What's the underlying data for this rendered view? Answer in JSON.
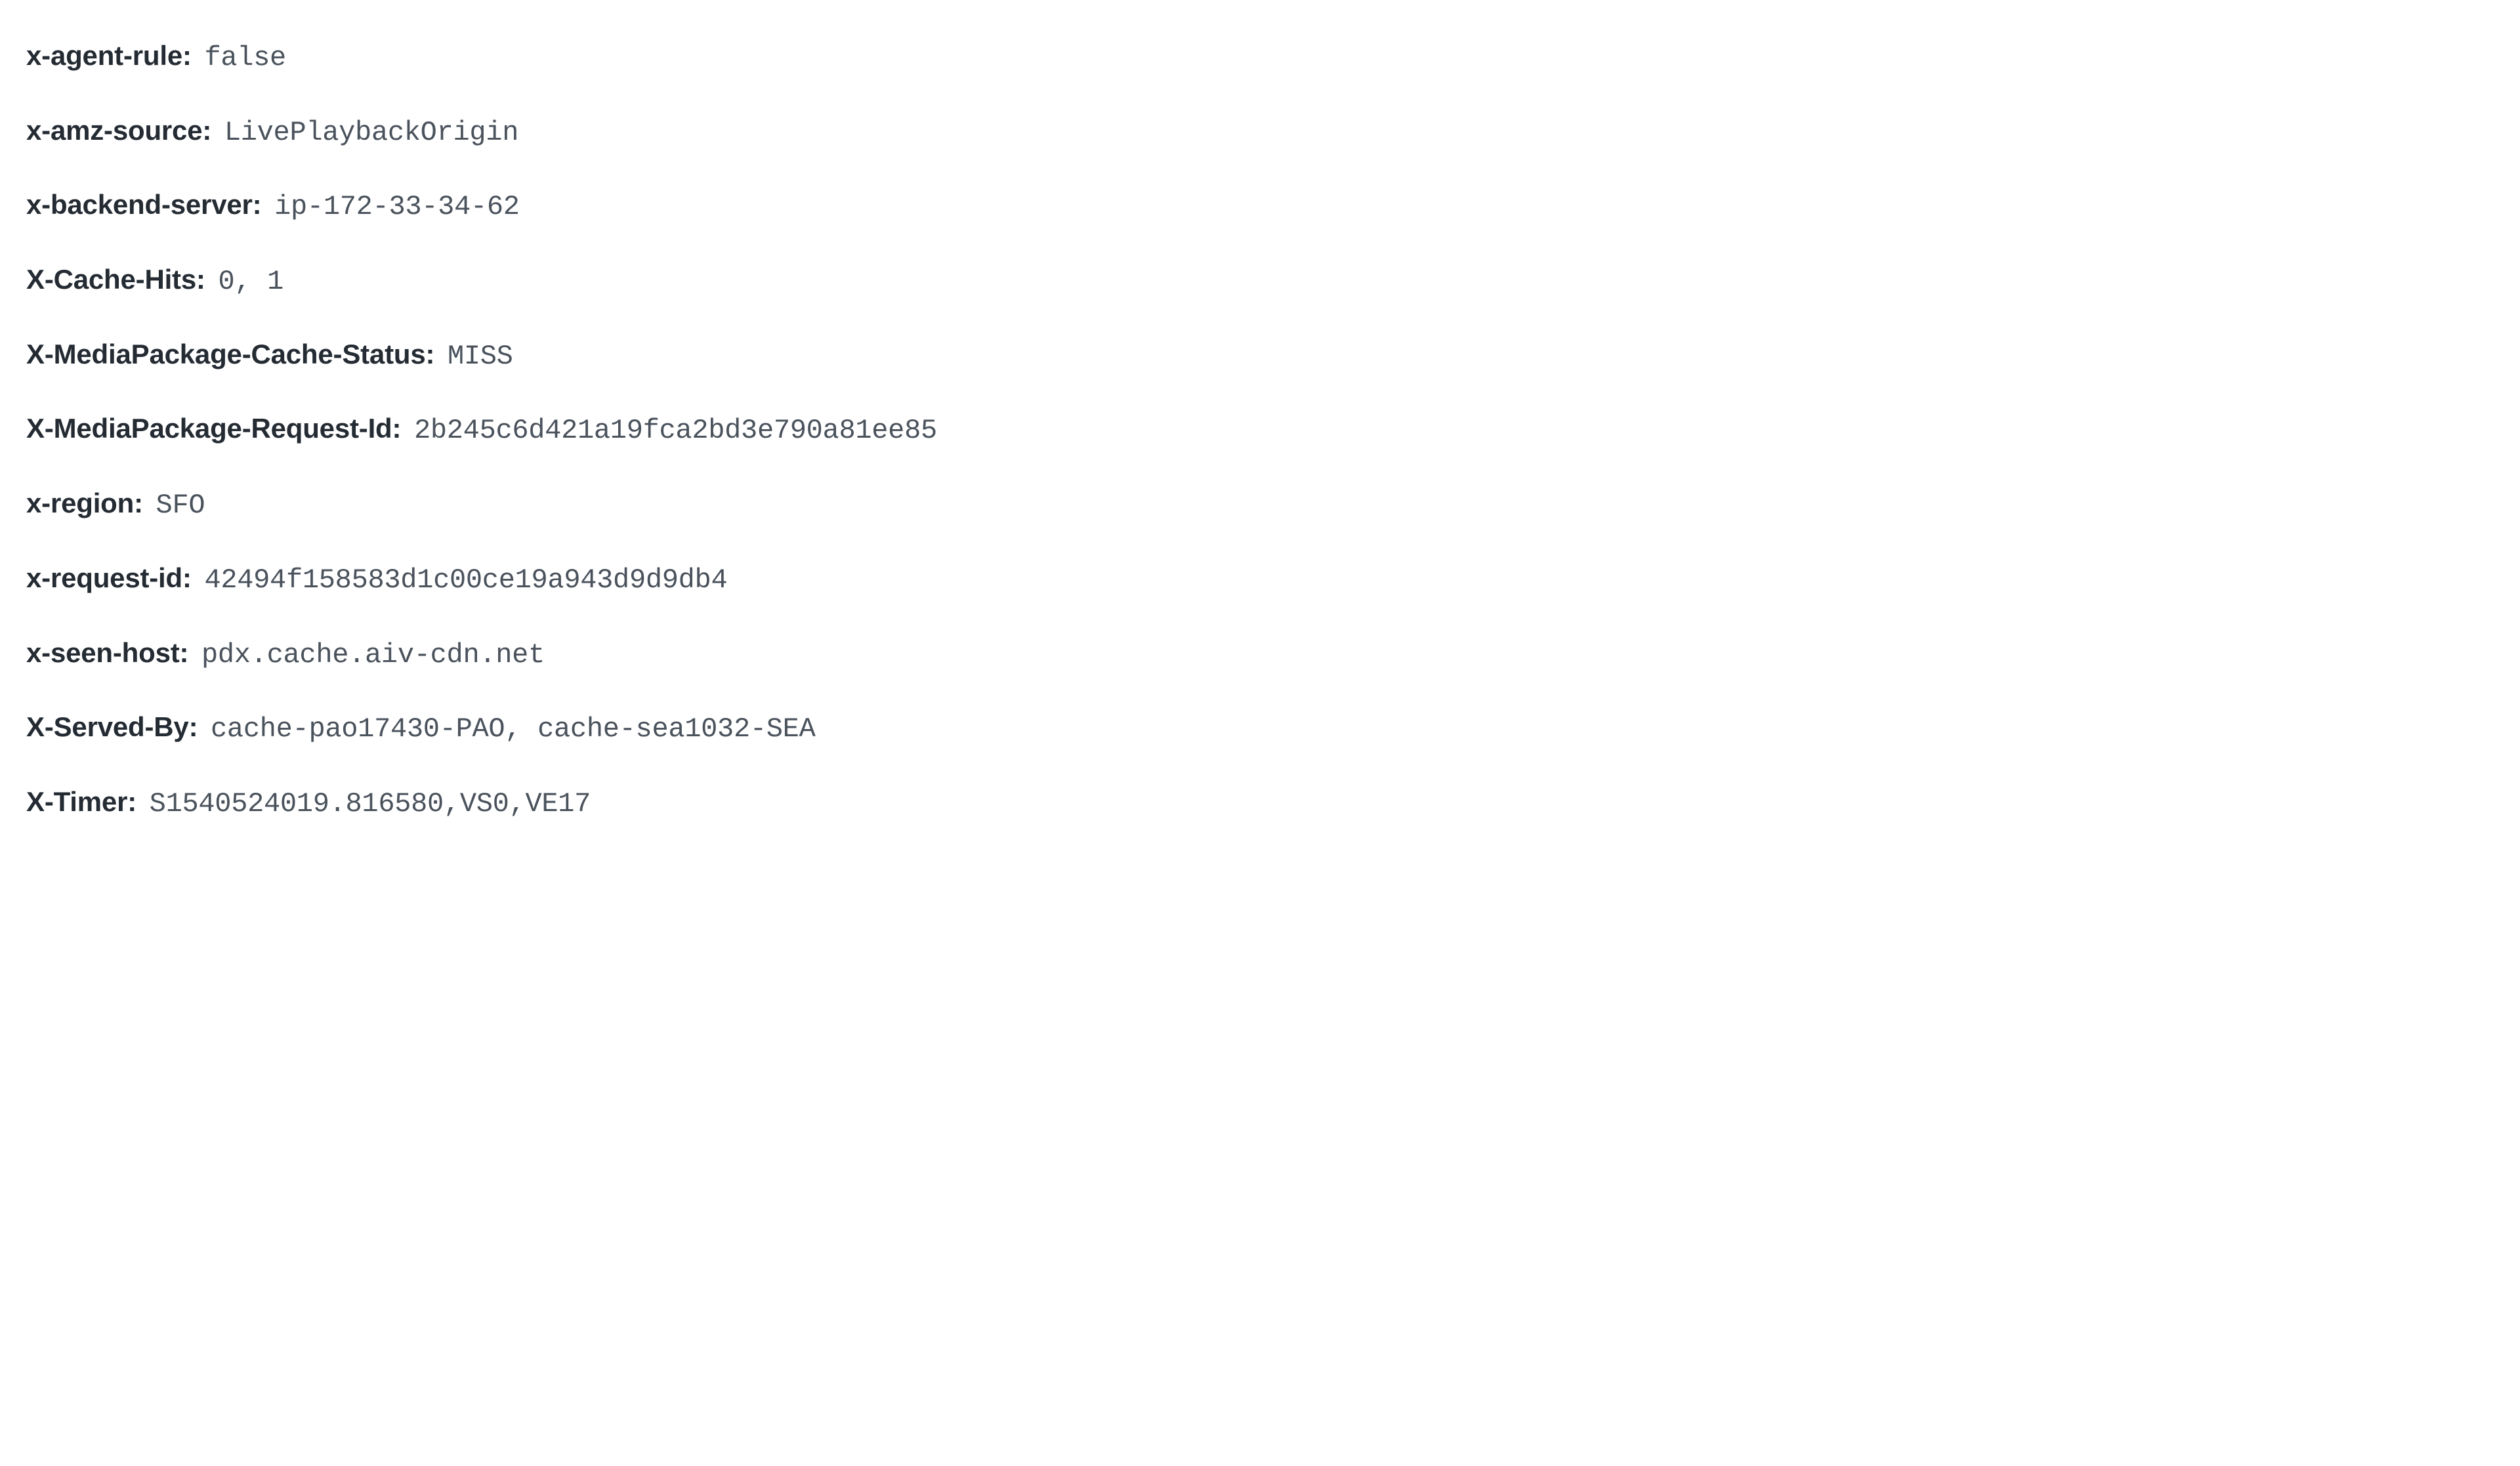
{
  "headers": [
    {
      "name": "x-agent-rule:",
      "value": "false"
    },
    {
      "name": "x-amz-source:",
      "value": "LivePlaybackOrigin"
    },
    {
      "name": "x-backend-server:",
      "value": "ip-172-33-34-62"
    },
    {
      "name": "X-Cache-Hits:",
      "value": "0, 1"
    },
    {
      "name": "X-MediaPackage-Cache-Status:",
      "value": "MISS"
    },
    {
      "name": "X-MediaPackage-Request-Id:",
      "value": "2b245c6d421a19fca2bd3e790a81ee85"
    },
    {
      "name": "x-region:",
      "value": "SFO"
    },
    {
      "name": "x-request-id:",
      "value": "42494f158583d1c00ce19a943d9d9db4"
    },
    {
      "name": "x-seen-host:",
      "value": "pdx.cache.aiv-cdn.net"
    },
    {
      "name": "X-Served-By:",
      "value": "cache-pao17430-PAO, cache-sea1032-SEA"
    },
    {
      "name": "X-Timer:",
      "value": "S1540524019.816580,VS0,VE17"
    }
  ]
}
